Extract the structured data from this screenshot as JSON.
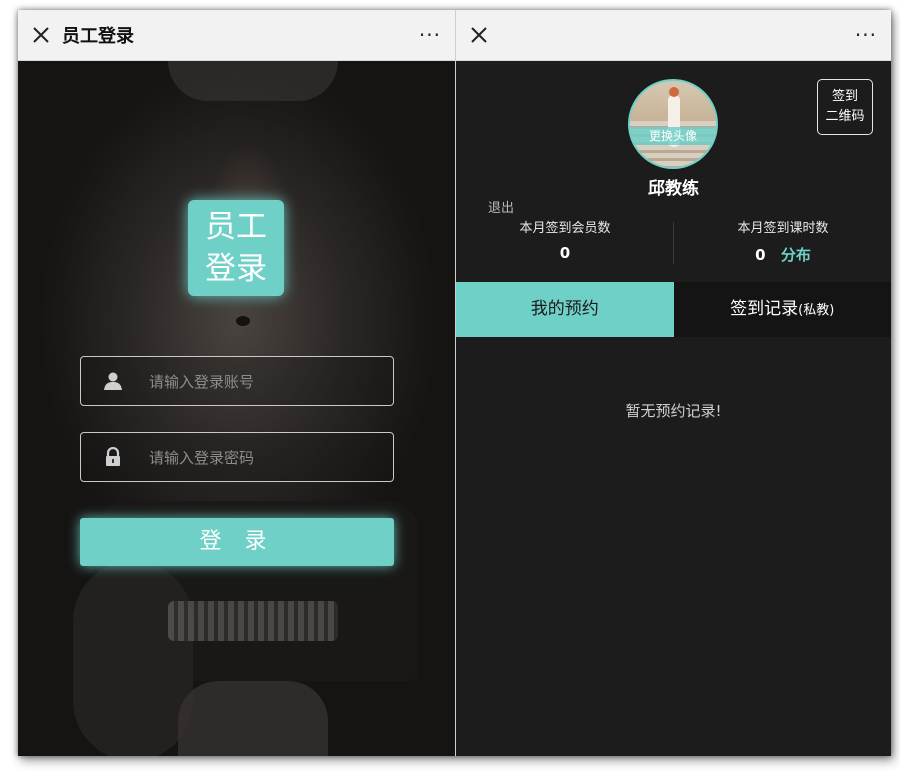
{
  "left": {
    "title": "员工登录",
    "more": "···",
    "logo": {
      "line1": "员工",
      "line2": "登录"
    },
    "username_placeholder": "请输入登录账号",
    "password_placeholder": "请输入登录密码",
    "login_label": "登 录"
  },
  "right": {
    "more": "···",
    "avatar_caption": "更换头像",
    "qr": {
      "line1": "签到",
      "line2": "二维码"
    },
    "coach_name": "邱教练",
    "logout": "退出",
    "stats": [
      {
        "label": "本月签到会员数",
        "value": "0"
      },
      {
        "label": "本月签到课时数",
        "value": "0",
        "link": "分布"
      }
    ],
    "tabs": [
      {
        "label": "我的预约"
      },
      {
        "label": "签到记录",
        "suffix": "(私教)"
      }
    ],
    "empty_message": "暂无预约记录!"
  },
  "colors": {
    "accent": "#6fd0c8",
    "dark_bg": "#1c1c1c"
  },
  "icons": [
    "close-icon",
    "more-icon",
    "user-icon",
    "lock-icon"
  ]
}
